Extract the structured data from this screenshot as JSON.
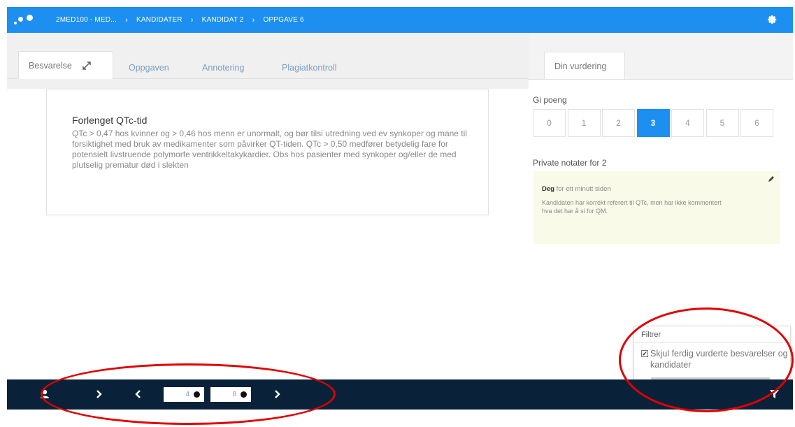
{
  "header": {
    "breadcrumbs": [
      "2MED100 - MED...",
      "KANDIDATER",
      "KANDIDAT 2",
      "OPPGAVE 6"
    ]
  },
  "left": {
    "tabs": [
      {
        "label": "Besvarelse",
        "active": true
      },
      {
        "label": "Oppgaven",
        "active": false
      },
      {
        "label": "Annotering",
        "active": false
      },
      {
        "label": "Plagiatkontroll",
        "active": false
      }
    ],
    "answer": {
      "title": "Forlenget QTc-tid",
      "body": "QTc > 0,47 hos kvinner og > 0,46 hos menn er unormalt, og bør tilsi utredning ved ev synkoper og mane til forsiktighet med bruk av medikamenter som påvirker QT-tiden. QTc > 0,50 medfører betydelig fare for potensielt livstruende polymorfe ventrikkeltakykardier. Obs hos pasienter med synkoper og/eller de med plutselig prematur død i slekten"
    }
  },
  "right": {
    "tab_label": "Din vurdering",
    "score_label": "Gi poeng",
    "scores": [
      "0",
      "1",
      "2",
      "3",
      "4",
      "5",
      "6"
    ],
    "selected_score": "3",
    "notes_label": "Private notater for 2",
    "note": {
      "author": "Deg",
      "time": "for ett minutt siden",
      "text": "Kandidaten har korrekt referert til QTc, men har ikke kommentert hva det har å si for QM."
    }
  },
  "filter": {
    "title": "Filtrer",
    "option": "Skjul ferdig vurderte besvarelser og kandidater",
    "checked": true
  },
  "bottom": {
    "pager1": "4",
    "pager2": "8"
  },
  "colors": {
    "header_blue": "#1c8ff0",
    "bottom_navy": "#0a2239",
    "annotation_red": "#e00000",
    "note_bg": "#fafae8"
  }
}
